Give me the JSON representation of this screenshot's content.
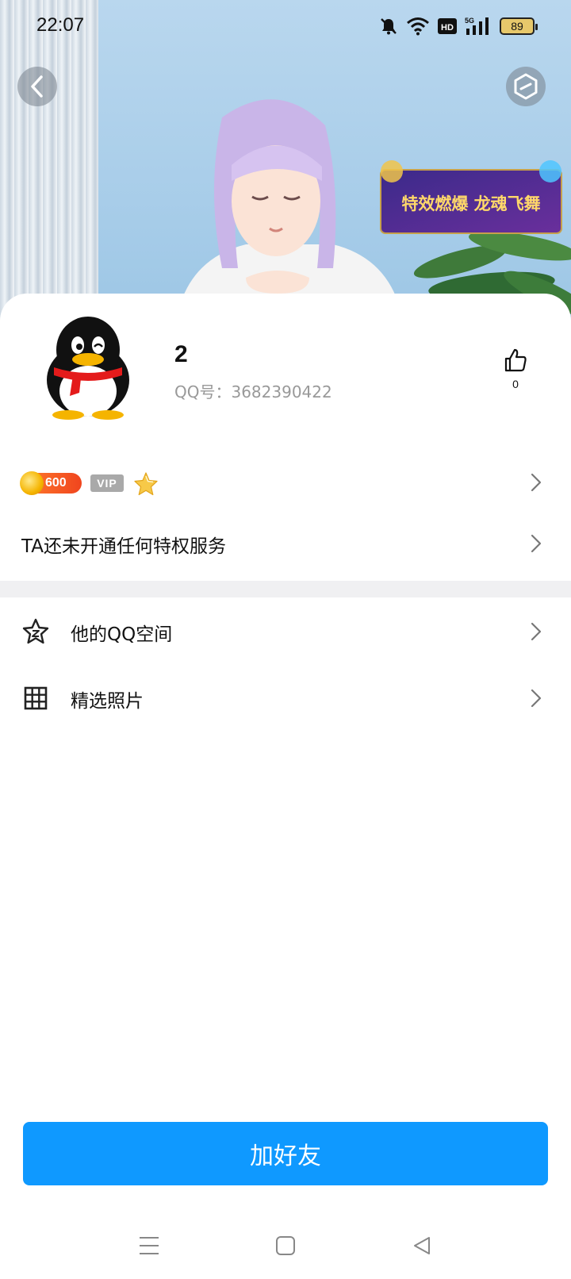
{
  "status_bar": {
    "time": "22:07",
    "battery": "89",
    "icons": [
      "bell-off-icon",
      "wifi-icon",
      "hd-icon",
      "signal-5g-icon",
      "battery-icon"
    ]
  },
  "header": {
    "back_icon": "chevron-left-icon",
    "more_icon": "hexagon-icon",
    "banner_text": "特效燃爆 龙魂飞舞"
  },
  "profile": {
    "name": "2",
    "qq_label": "QQ号：",
    "qq_number": "3682390422",
    "likes": "0"
  },
  "badges": {
    "coin_value": "600",
    "vip_label": "VIP"
  },
  "privilege_text": "TA还未开通任何特权服务",
  "menu": [
    {
      "label": "他的QQ空间",
      "icon": "star-outline-icon"
    },
    {
      "label": "精选照片",
      "icon": "grid-icon"
    }
  ],
  "primary_action": "加好友",
  "colors": {
    "accent": "#0f99ff",
    "divider": "#f0f0f2",
    "secondary_text": "#999999"
  }
}
